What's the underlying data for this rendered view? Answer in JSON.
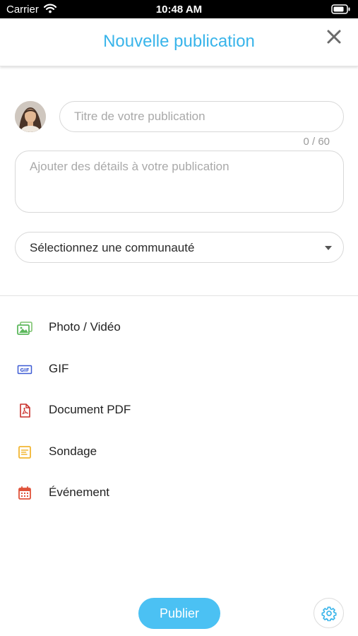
{
  "status_bar": {
    "carrier": "Carrier",
    "time": "10:48 AM"
  },
  "header": {
    "title": "Nouvelle publication",
    "close_icon": "close-icon"
  },
  "form": {
    "title_placeholder": "Titre de votre publication",
    "title_value": "",
    "counter": "0 / 60",
    "details_placeholder": "Ajouter des détails à votre publication",
    "details_value": "",
    "community_select": "Sélectionnez une communauté"
  },
  "options": [
    {
      "label": "Photo / Vidéo",
      "icon": "image-icon",
      "color": "#5cb85c"
    },
    {
      "label": "GIF",
      "icon": "gif-icon",
      "color": "#3d5bd4"
    },
    {
      "label": "Document PDF",
      "icon": "pdf-icon",
      "color": "#c9302c"
    },
    {
      "label": "Sondage",
      "icon": "poll-icon",
      "color": "#f2b632"
    },
    {
      "label": "Événement",
      "icon": "calendar-icon",
      "color": "#e0533b"
    }
  ],
  "footer": {
    "publish_label": "Publier",
    "settings_icon": "gear-icon"
  },
  "colors": {
    "accent": "#38b4ea",
    "button": "#4bc1f3"
  }
}
